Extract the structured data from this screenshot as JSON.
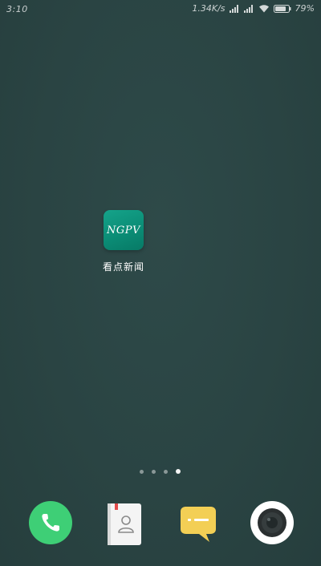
{
  "status_bar": {
    "time": "3:10",
    "network_speed": "1.34K/s",
    "battery": "79%"
  },
  "home": {
    "apps": [
      {
        "icon_text": "NGPV",
        "label": "看点新闻",
        "icon_color": "#0b8d76"
      }
    ],
    "page_count": 4,
    "active_page": 4
  },
  "dock": {
    "items": [
      "phone-icon",
      "contacts-icon",
      "messages-icon",
      "camera-icon"
    ],
    "colors": {
      "phone": "#3ecf76",
      "contacts": "#f2f2f2",
      "messages": "#f3cf55",
      "camera": "#ffffff"
    }
  }
}
